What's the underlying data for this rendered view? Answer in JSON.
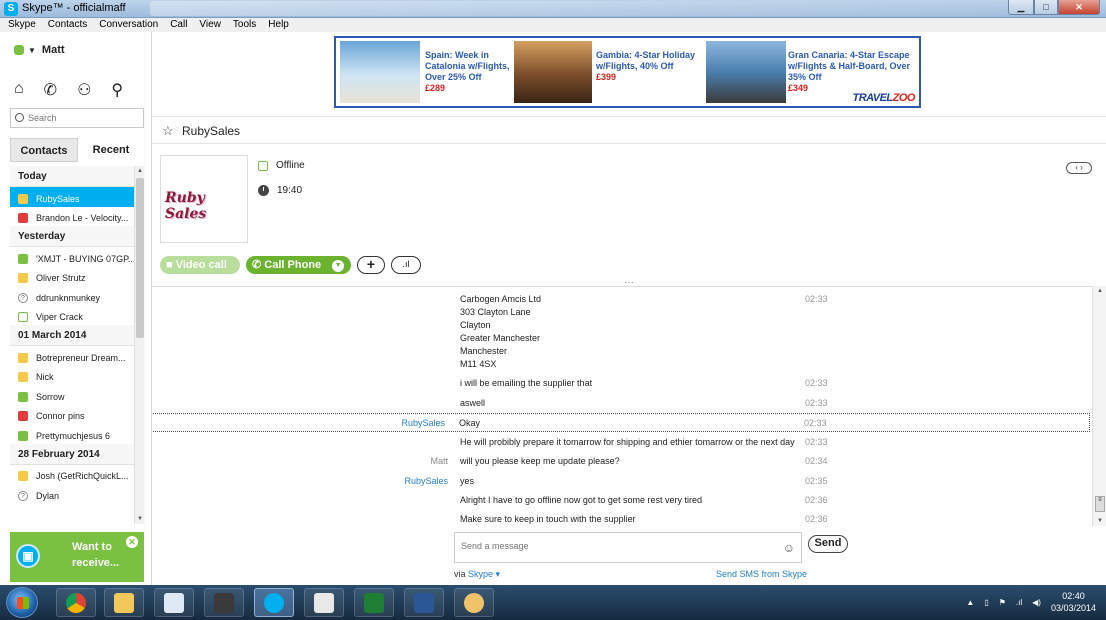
{
  "window": {
    "title": "Skype™ - officialmaff",
    "app_badge": "S"
  },
  "menu": [
    "Skype",
    "Contacts",
    "Conversation",
    "Call",
    "View",
    "Tools",
    "Help"
  ],
  "profile": {
    "name": "Matt"
  },
  "search": {
    "placeholder": "Search"
  },
  "tabs": {
    "contacts": "Contacts",
    "recent": "Recent"
  },
  "recent_groups": [
    {
      "label": "Today",
      "items": [
        {
          "name": "RubySales",
          "status": "offline-yellow",
          "selected": true
        },
        {
          "name": "Brandon Le - Velocity...",
          "status": "red"
        }
      ]
    },
    {
      "label": "Yesterday",
      "items": [
        {
          "name": "'XMJT - BUYING 07GP...",
          "status": "green"
        },
        {
          "name": "Oliver Strutz",
          "status": "yellow"
        },
        {
          "name": "ddrunknmunkey",
          "status": "unknown"
        },
        {
          "name": "Viper Crack",
          "status": "offline"
        }
      ]
    },
    {
      "label": "01 March 2014",
      "items": [
        {
          "name": "Botrepreneur Dream...",
          "status": "yellow"
        },
        {
          "name": "Nick",
          "status": "yellow"
        },
        {
          "name": "Sorrow",
          "status": "green"
        },
        {
          "name": "Connor pins",
          "status": "red"
        },
        {
          "name": "Prettymuchjesus 6",
          "status": "green"
        }
      ]
    },
    {
      "label": "28 February 2014",
      "items": [
        {
          "name": "Josh (GetRichQuickL...",
          "status": "yellow"
        },
        {
          "name": "Dylan",
          "status": "unknown"
        }
      ]
    }
  ],
  "promo": {
    "line1": "Want to",
    "line2": "receive..."
  },
  "ad": {
    "deals": [
      {
        "title": "Spain: Week in Catalonia w/Flights, Over 25% Off",
        "price": "£289"
      },
      {
        "title": "Gambia: 4-Star Holiday w/Flights, 40% Off",
        "price": "£399"
      },
      {
        "title": "Gran Canaria: 4-Star Escape w/Flights & Half-Board, Over 35% Off",
        "price": "£349"
      }
    ],
    "brand_main": "TRAVEL",
    "brand_accent": "ZOO"
  },
  "conversation": {
    "name": "RubySales",
    "avatar_text": "Ruby Sales",
    "status": "Offline",
    "local_time": "19:40",
    "buttons": {
      "video": "Video call",
      "call": "Call Phone",
      "plus": "+",
      "signal": ".ıl"
    }
  },
  "messages": [
    {
      "sender": "",
      "text": "Carbogen Amcis Ltd\n303 Clayton Lane\nClayton\nGreater Manchester\nManchester\nM11 4SX",
      "time": "02:33"
    },
    {
      "sender": "",
      "text": "i will be emailing the supplier that",
      "time": "02:33"
    },
    {
      "sender": "",
      "text": "aswell",
      "time": "02:33"
    },
    {
      "sender": "RubySales",
      "text": "Okay",
      "time": "02:33",
      "selected": true
    },
    {
      "sender": "",
      "text": "He will probibly prepare it tomarrow for shipping and ethier tomarrow or the next day",
      "time": "02:33"
    },
    {
      "sender": "Matt",
      "text": "will you please keep me update please?",
      "time": "02:34",
      "me": true
    },
    {
      "sender": "RubySales",
      "text": "yes",
      "time": "02:35"
    },
    {
      "sender": "",
      "text": "Alright I have to go offline now got to get some rest very tired",
      "time": "02:36"
    },
    {
      "sender": "",
      "text": "Make sure to keep in touch with the supplier",
      "time": "02:36"
    }
  ],
  "compose": {
    "placeholder": "Send a message",
    "send": "Send",
    "via_prefix": "via",
    "via_service": "Skype ▾",
    "sms": "Send SMS from Skype"
  },
  "taskbar": {
    "time": "02:40",
    "date": "03/03/2014"
  }
}
